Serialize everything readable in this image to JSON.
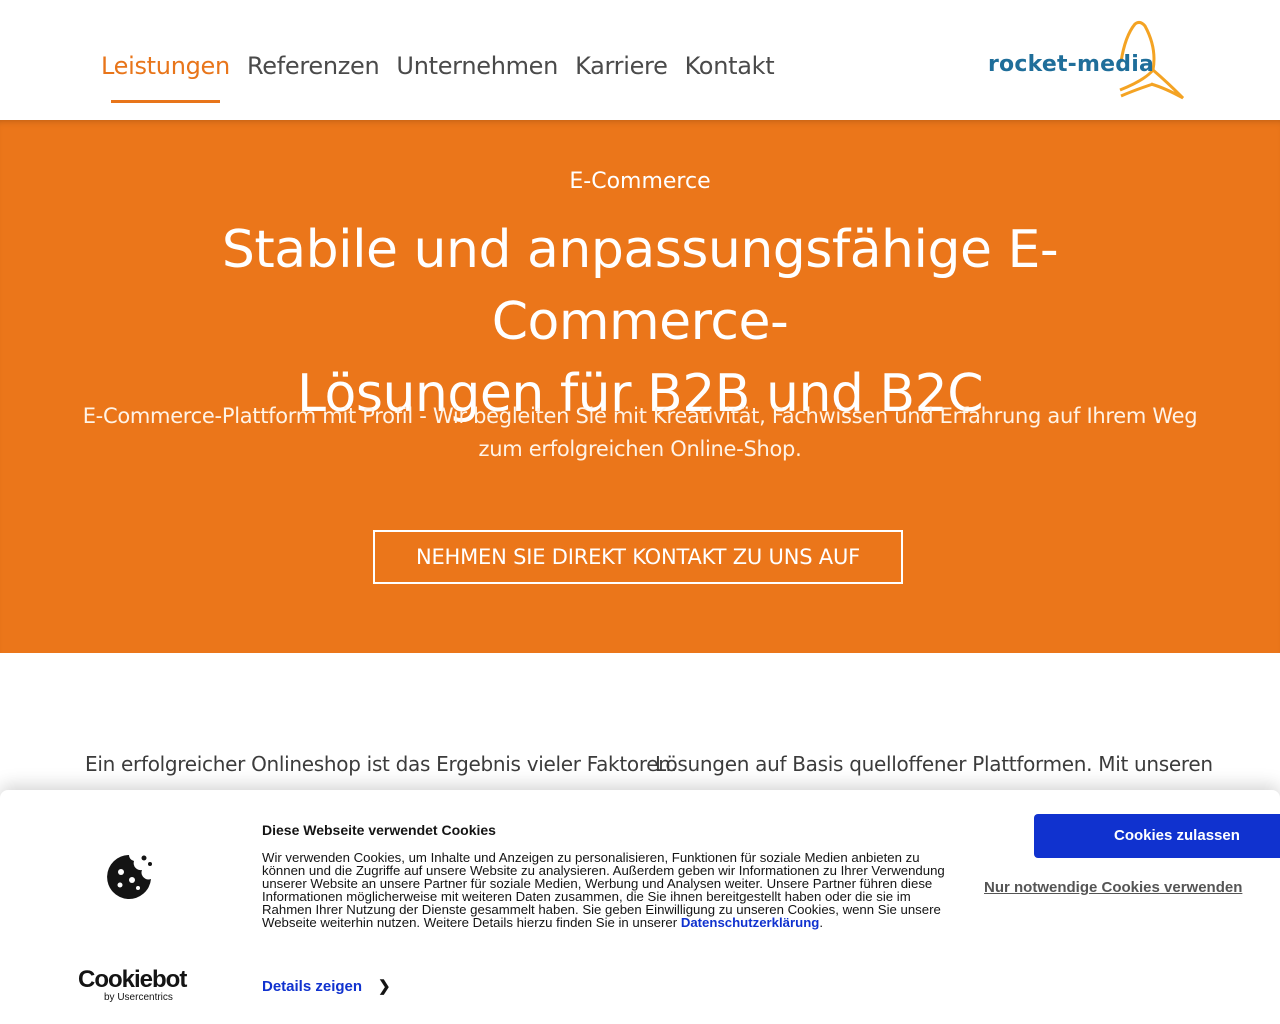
{
  "header": {
    "nav": [
      {
        "label": "Leistungen",
        "active": true
      },
      {
        "label": "Referenzen",
        "active": false
      },
      {
        "label": "Unternehmen",
        "active": false
      },
      {
        "label": "Karriere",
        "active": false
      },
      {
        "label": "Kontakt",
        "active": false
      }
    ],
    "logo_text": "rocket-media"
  },
  "hero": {
    "eyebrow": "E-Commerce",
    "headline_line1": "Stabile und anpassungsfähige E-Commerce-",
    "headline_line2": "Lösungen für B2B und B2C",
    "subtitle": "E-Commerce-Plattform mit Profil -  Wir begleiten Sie mit Kreativität, Fachwissen und Erfahrung auf Ihrem Weg zum erfolgreichen Online-Shop.",
    "cta_label": "NEHMEN SIE DIREKT KONTAKT ZU UNS AUF"
  },
  "content": {
    "col1": "Ein erfolgreicher Onlineshop ist das Ergebnis vieler Faktoren.",
    "col2": "Lösungen auf Basis quelloffener Plattformen. Mit unseren"
  },
  "cookie_banner": {
    "title": "Diese Webseite verwendet Cookies",
    "text": "Wir verwenden Cookies, um Inhalte und Anzeigen zu personalisieren, Funktionen für soziale Medien anbieten zu können und die Zugriffe auf unsere Website zu analysieren. Außerdem geben wir Informationen zu Ihrer Verwendung unserer Website an unsere Partner für soziale Medien, Werbung und Analysen weiter. Unsere Partner führen diese Informationen möglicherweise mit weiteren Daten zusammen, die Sie ihnen bereitgestellt haben oder die sie im Rahmen Ihrer Nutzung der Dienste gesammelt haben. Sie geben Einwilligung zu unseren Cookies, wenn Sie unsere Webseite weiterhin nutzen. Weitere Details hierzu finden Sie in unserer ",
    "privacy_link": "Datenschutzerklärung",
    "text_end": ".",
    "details_label": "Details zeigen",
    "allow_label": "Cookies zulassen",
    "necessary_label": "Nur notwendige Cookies verwenden",
    "brand": "Cookiebot",
    "brand_sub": "by Usercentrics"
  },
  "colors": {
    "accent": "#eb761a",
    "logo_blue": "#1f6e9a",
    "cookie_blue": "#1032cf"
  }
}
